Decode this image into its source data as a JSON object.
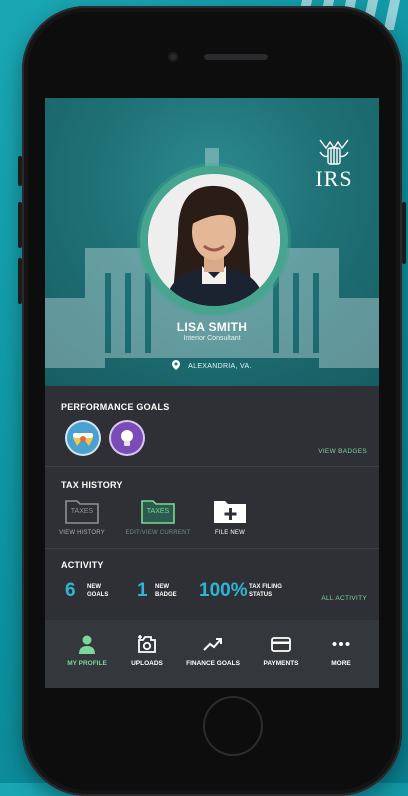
{
  "profile": {
    "name": "LISA SMITH",
    "role": "Interior Consultant",
    "location": "ALEXANDRIA, VA."
  },
  "brand": {
    "logo_text": "IRS",
    "accent": "#7bd79a",
    "stat_color": "#2db6d6"
  },
  "performance": {
    "title": "PERFORMANCE GOALS",
    "link": "VIEW BADGES",
    "badges": [
      {
        "icon": "wings-badge-icon",
        "color": "#4aa0d0"
      },
      {
        "icon": "lightbulb-badge-icon",
        "color": "#7b4bb8"
      }
    ]
  },
  "tax_history": {
    "title": "TAX HISTORY",
    "folder_text": "TAXES",
    "items": [
      {
        "label": "VIEW HISTORY"
      },
      {
        "label": "EDIT/VIEW CURRENT"
      },
      {
        "label": "FILE NEW"
      }
    ]
  },
  "activity": {
    "title": "ACTIVITY",
    "link": "ALL ACTIVITY",
    "stats": [
      {
        "value": "6",
        "line1": "NEW",
        "line2": "GOALS"
      },
      {
        "value": "1",
        "line1": "NEW",
        "line2": "BADGE"
      },
      {
        "value": "100%",
        "line1": "TAX FILING",
        "line2": "STATUS"
      }
    ]
  },
  "tabs": [
    {
      "label": "MY PROFILE",
      "icon": "person-icon",
      "active": true
    },
    {
      "label": "UPLOADS",
      "icon": "camera-add-icon"
    },
    {
      "label": "FINANCE GOALS",
      "icon": "trend-up-icon"
    },
    {
      "label": "PAYMENTS",
      "icon": "credit-card-icon"
    },
    {
      "label": "MORE",
      "icon": "more-dots-icon"
    }
  ]
}
